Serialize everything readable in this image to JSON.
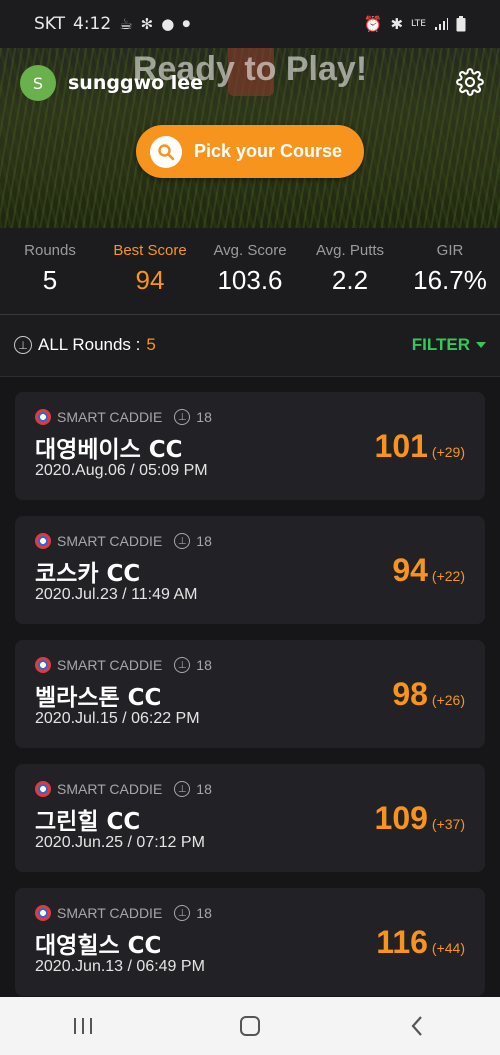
{
  "status_bar": {
    "carrier": "SKT",
    "time": "4:12",
    "network": "LTE",
    "icons": [
      "coffee-icon",
      "pinwheel-icon",
      "panda-icon",
      "dot-icon",
      "alarm-icon",
      "bluetooth-icon",
      "lte-icon",
      "signal-icon",
      "battery-icon"
    ]
  },
  "hero": {
    "title": "Ready to Play!",
    "user": {
      "initial": "S",
      "name": "sunggwo lee",
      "avatar_color": "#6ab04c"
    },
    "pick_button": "Pick your Course"
  },
  "stats": [
    {
      "label": "Rounds",
      "value": "5"
    },
    {
      "label": "Best Score",
      "value": "94"
    },
    {
      "label": "Avg. Score",
      "value": "103.6"
    },
    {
      "label": "Avg. Putts",
      "value": "2.2"
    },
    {
      "label": "GIR",
      "value": "16.7%"
    }
  ],
  "rounds_header": {
    "label": "ALL Rounds :",
    "count": "5",
    "filter": "FILTER"
  },
  "rounds": [
    {
      "source": "SMART CADDIE",
      "holes": "18",
      "course": "대영베이스 CC",
      "date": "2020.Aug.06 / 05:09 PM",
      "score": "101",
      "diff": "(+29)"
    },
    {
      "source": "SMART CADDIE",
      "holes": "18",
      "course": "코스카 CC",
      "date": "2020.Jul.23 / 11:49 AM",
      "score": "94",
      "diff": "(+22)"
    },
    {
      "source": "SMART CADDIE",
      "holes": "18",
      "course": "벨라스톤 CC",
      "date": "2020.Jul.15 / 06:22 PM",
      "score": "98",
      "diff": "(+26)"
    },
    {
      "source": "SMART CADDIE",
      "holes": "18",
      "course": "그린힐 CC",
      "date": "2020.Jun.25 / 07:12 PM",
      "score": "109",
      "diff": "(+37)"
    },
    {
      "source": "SMART CADDIE",
      "holes": "18",
      "course": "대영힐스 CC",
      "date": "2020.Jun.13 / 06:49 PM",
      "score": "116",
      "diff": "(+44)"
    }
  ],
  "colors": {
    "accent": "#f7941d",
    "filter": "#35c759",
    "background": "#1c1c1f",
    "card": "#222226"
  }
}
